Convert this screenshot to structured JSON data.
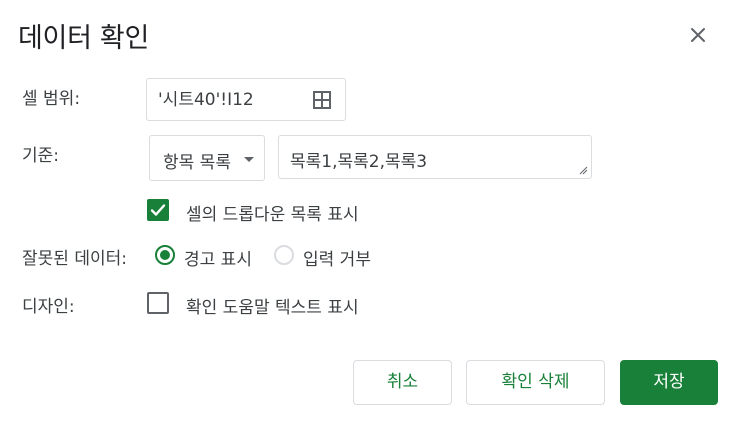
{
  "dialog": {
    "title": "데이터 확인",
    "close_icon": "close-icon"
  },
  "cell_range": {
    "label": "셀 범위:",
    "value": "'시트40'!I12",
    "icon": "grid-select-icon"
  },
  "criteria": {
    "label": "기준:",
    "type_selected": "항목 목록",
    "items_value": "목록1,목록2,목록3",
    "show_dropdown_label": "셀의 드롭다운 목록 표시",
    "show_dropdown_checked": true
  },
  "invalid_data": {
    "label": "잘못된 데이터:",
    "options": [
      {
        "label": "경고 표시",
        "selected": true
      },
      {
        "label": "입력 거부",
        "selected": false
      }
    ]
  },
  "appearance": {
    "label": "디자인:",
    "help_text_label": "확인 도움말 텍스트 표시",
    "help_text_checked": false
  },
  "buttons": {
    "cancel": "취소",
    "remove": "확인 삭제",
    "save": "저장"
  },
  "colors": {
    "accent": "#188038",
    "border": "#dadce0",
    "text": "#3c4043"
  }
}
